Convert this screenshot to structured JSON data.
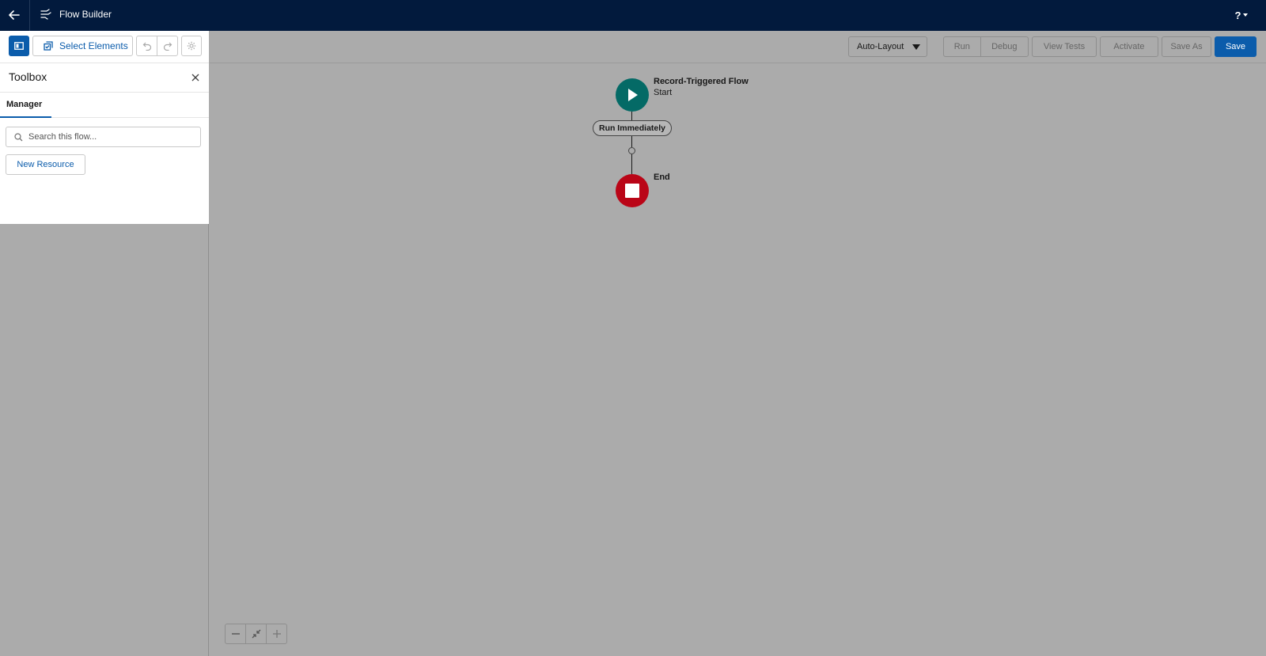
{
  "header": {
    "app_title": "Flow Builder",
    "help_label": "?"
  },
  "left_toolbar": {
    "select_elements_label": "Select Elements"
  },
  "toolbox": {
    "title": "Toolbox",
    "tabs": [
      {
        "label": "Manager",
        "active": true
      }
    ],
    "search_placeholder": "Search this flow...",
    "new_resource_label": "New Resource"
  },
  "canvas_toolbar": {
    "layout_value": "Auto-Layout",
    "run_label": "Run",
    "debug_label": "Debug",
    "view_tests_label": "View Tests",
    "activate_label": "Activate",
    "save_as_label": "Save As",
    "save_label": "Save"
  },
  "flow": {
    "start_title": "Record-Triggered Flow",
    "start_subtitle": "Start",
    "path_label": "Run Immediately",
    "end_title": "End"
  },
  "colors": {
    "header_bg": "#021a3d",
    "brand": "#0b5cab",
    "start_node": "#046a66",
    "end_node": "#ba0517",
    "canvas_overlay": "#ababab"
  },
  "icons": [
    "back-arrow-icon",
    "flow-builder-icon",
    "help-icon",
    "toggle-panel-icon",
    "select-elements-icon",
    "undo-icon",
    "redo-icon",
    "settings-gear-icon",
    "close-icon",
    "search-icon",
    "play-icon",
    "stop-icon",
    "zoom-out-icon",
    "fit-to-view-icon",
    "zoom-in-icon"
  ]
}
